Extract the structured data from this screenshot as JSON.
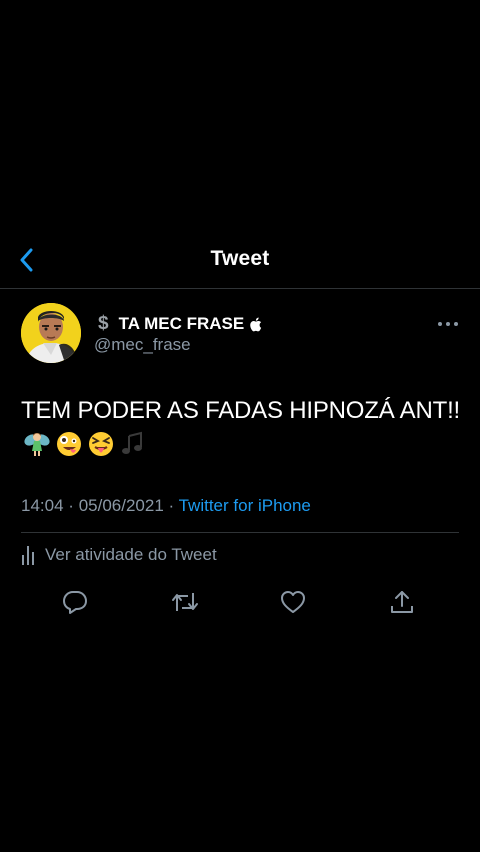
{
  "header": {
    "title": "Tweet",
    "back_icon": "chevron-left-icon"
  },
  "tweet": {
    "display_name": "TA MEC FRASE",
    "name_prefix_emoji": "$",
    "name_badge_icon": "apple-icon",
    "handle": "@mec_frase",
    "text": "TEM PODER AS FADAS HIPNOZÁ ANT!!",
    "emojis": [
      "fairy",
      "zany-face",
      "squinting-tongue-face",
      "musical-notes"
    ],
    "time": "14:04",
    "separator": "·",
    "date": "05/06/2021",
    "source": "Twitter for iPhone",
    "activity_label": "Ver atividade do Tweet"
  },
  "actions": [
    "reply-icon",
    "retweet-icon",
    "like-icon",
    "share-icon"
  ],
  "colors": {
    "background": "#000000",
    "accent": "#1d9bf0",
    "secondary_text": "#8b98a5",
    "divider": "#2f3336",
    "avatar_bg": "#f2d21c"
  }
}
